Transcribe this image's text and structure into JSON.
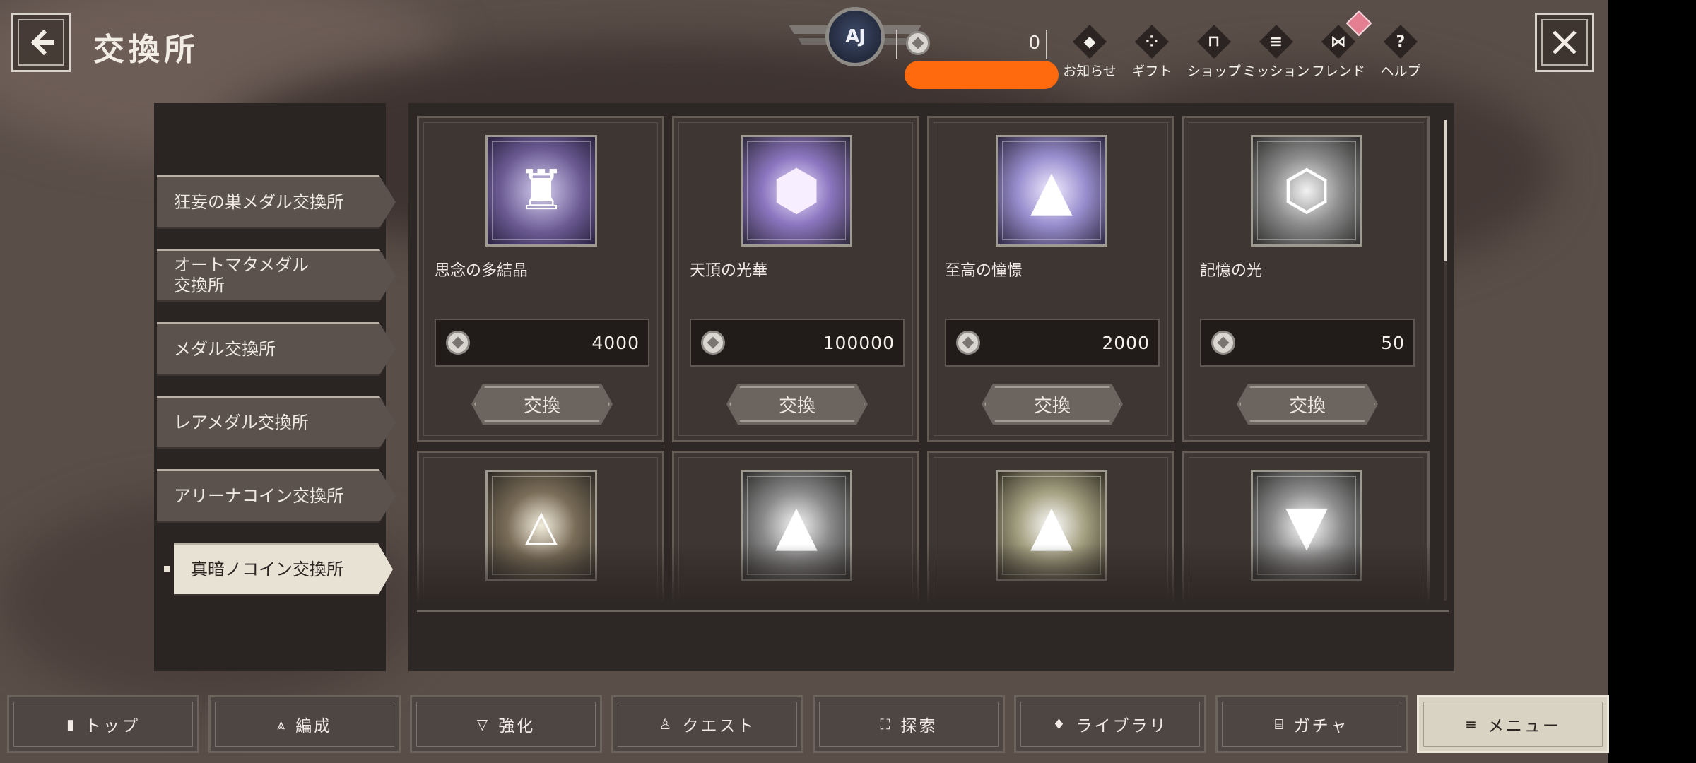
{
  "header": {
    "title": "交換所",
    "emblem_text": "AJ",
    "currency_value": "0",
    "nav": [
      {
        "label": "お知らせ",
        "icon": "diamond-dot-icon",
        "glyph": "◆"
      },
      {
        "label": "ギフト",
        "icon": "gift-icon",
        "glyph": "⁘"
      },
      {
        "label": "ショップ",
        "icon": "shop-icon",
        "glyph": "⊓"
      },
      {
        "label": "ミッション",
        "icon": "mission-list-icon",
        "glyph": "≡"
      },
      {
        "label": "フレンド",
        "icon": "friend-icon",
        "glyph": "⋈"
      },
      {
        "label": "ヘルプ",
        "icon": "help-icon",
        "glyph": "?"
      }
    ]
  },
  "tabs": [
    {
      "label": "狂妄の巣メダル交換所"
    },
    {
      "label": "オートマタメダル\n交換所"
    },
    {
      "label": "メダル交換所"
    },
    {
      "label": "レアメダル交換所"
    },
    {
      "label": "アリーナコイン交換所"
    },
    {
      "label": "真暗ノコイン交換所"
    }
  ],
  "items": [
    {
      "name": "思念の多結晶",
      "price": "4000",
      "button": "交換"
    },
    {
      "name": "天頂の光華",
      "price": "100000",
      "button": "交換"
    },
    {
      "name": "至高の憧憬",
      "price": "2000",
      "button": "交換"
    },
    {
      "name": "記憶の光",
      "price": "50",
      "button": "交換"
    },
    {
      "name": "",
      "price": "",
      "button": ""
    },
    {
      "name": "",
      "price": "",
      "button": ""
    },
    {
      "name": "",
      "price": "",
      "button": ""
    },
    {
      "name": "",
      "price": "",
      "button": ""
    }
  ],
  "bottom_nav": [
    {
      "label": "トップ",
      "icon": "home-icon"
    },
    {
      "label": "編成",
      "icon": "formation-icon"
    },
    {
      "label": "強化",
      "icon": "enhance-icon"
    },
    {
      "label": "クエスト",
      "icon": "quest-icon"
    },
    {
      "label": "探索",
      "icon": "explore-icon"
    },
    {
      "label": "ライブラリ",
      "icon": "library-icon"
    },
    {
      "label": "ガチャ",
      "icon": "gacha-icon"
    },
    {
      "label": "メニュー",
      "icon": "menu-icon"
    }
  ],
  "colors": {
    "active_tab": "#e7e2d4",
    "redaction": "#ff6a0f",
    "panel": "#2d2725"
  }
}
